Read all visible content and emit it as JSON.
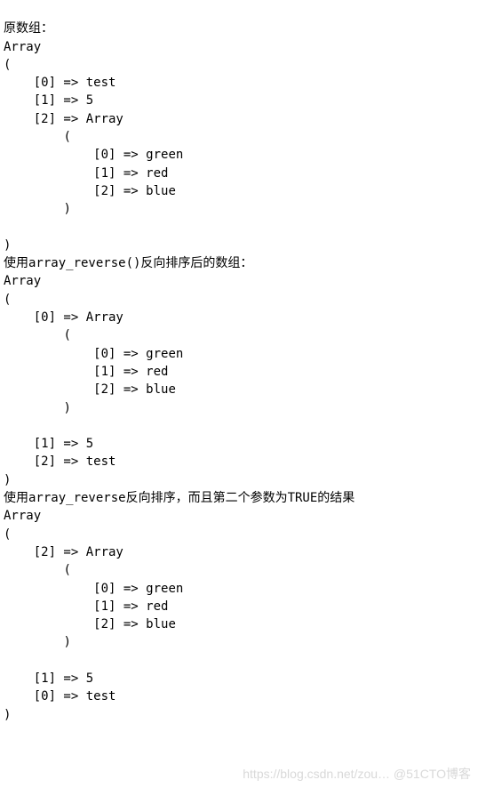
{
  "sections": [
    {
      "heading": "原数组：",
      "array_word": "Array",
      "open": "(",
      "close": ")",
      "entries": [
        {
          "indent": 1,
          "line": "[0] => test"
        },
        {
          "indent": 1,
          "line": "[1] => 5"
        },
        {
          "indent": 1,
          "line": "[2] => Array"
        },
        {
          "indent": 2,
          "line": "("
        },
        {
          "indent": 3,
          "line": "[0] => green"
        },
        {
          "indent": 3,
          "line": "[1] => red"
        },
        {
          "indent": 3,
          "line": "[2] => blue"
        },
        {
          "indent": 2,
          "line": ")"
        }
      ]
    },
    {
      "heading": "使用array_reverse()反向排序后的数组：",
      "array_word": "Array",
      "open": "(",
      "close": ")",
      "entries": [
        {
          "indent": 1,
          "line": "[0] => Array"
        },
        {
          "indent": 2,
          "line": "("
        },
        {
          "indent": 3,
          "line": "[0] => green"
        },
        {
          "indent": 3,
          "line": "[1] => red"
        },
        {
          "indent": 3,
          "line": "[2] => blue"
        },
        {
          "indent": 2,
          "line": ")"
        },
        {
          "indent": 0,
          "line": ""
        },
        {
          "indent": 1,
          "line": "[1] => 5"
        },
        {
          "indent": 1,
          "line": "[2] => test"
        }
      ]
    },
    {
      "heading": "使用array_reverse反向排序，而且第二个参数为TRUE的结果",
      "array_word": "Array",
      "open": "(",
      "close": ")",
      "entries": [
        {
          "indent": 1,
          "line": "[2] => Array"
        },
        {
          "indent": 2,
          "line": "("
        },
        {
          "indent": 3,
          "line": "[0] => green"
        },
        {
          "indent": 3,
          "line": "[1] => red"
        },
        {
          "indent": 3,
          "line": "[2] => blue"
        },
        {
          "indent": 2,
          "line": ")"
        },
        {
          "indent": 0,
          "line": ""
        },
        {
          "indent": 1,
          "line": "[1] => 5"
        },
        {
          "indent": 1,
          "line": "[0] => test"
        }
      ]
    }
  ],
  "watermark": "https://blog.csdn.net/zou…  @51CTO博客"
}
